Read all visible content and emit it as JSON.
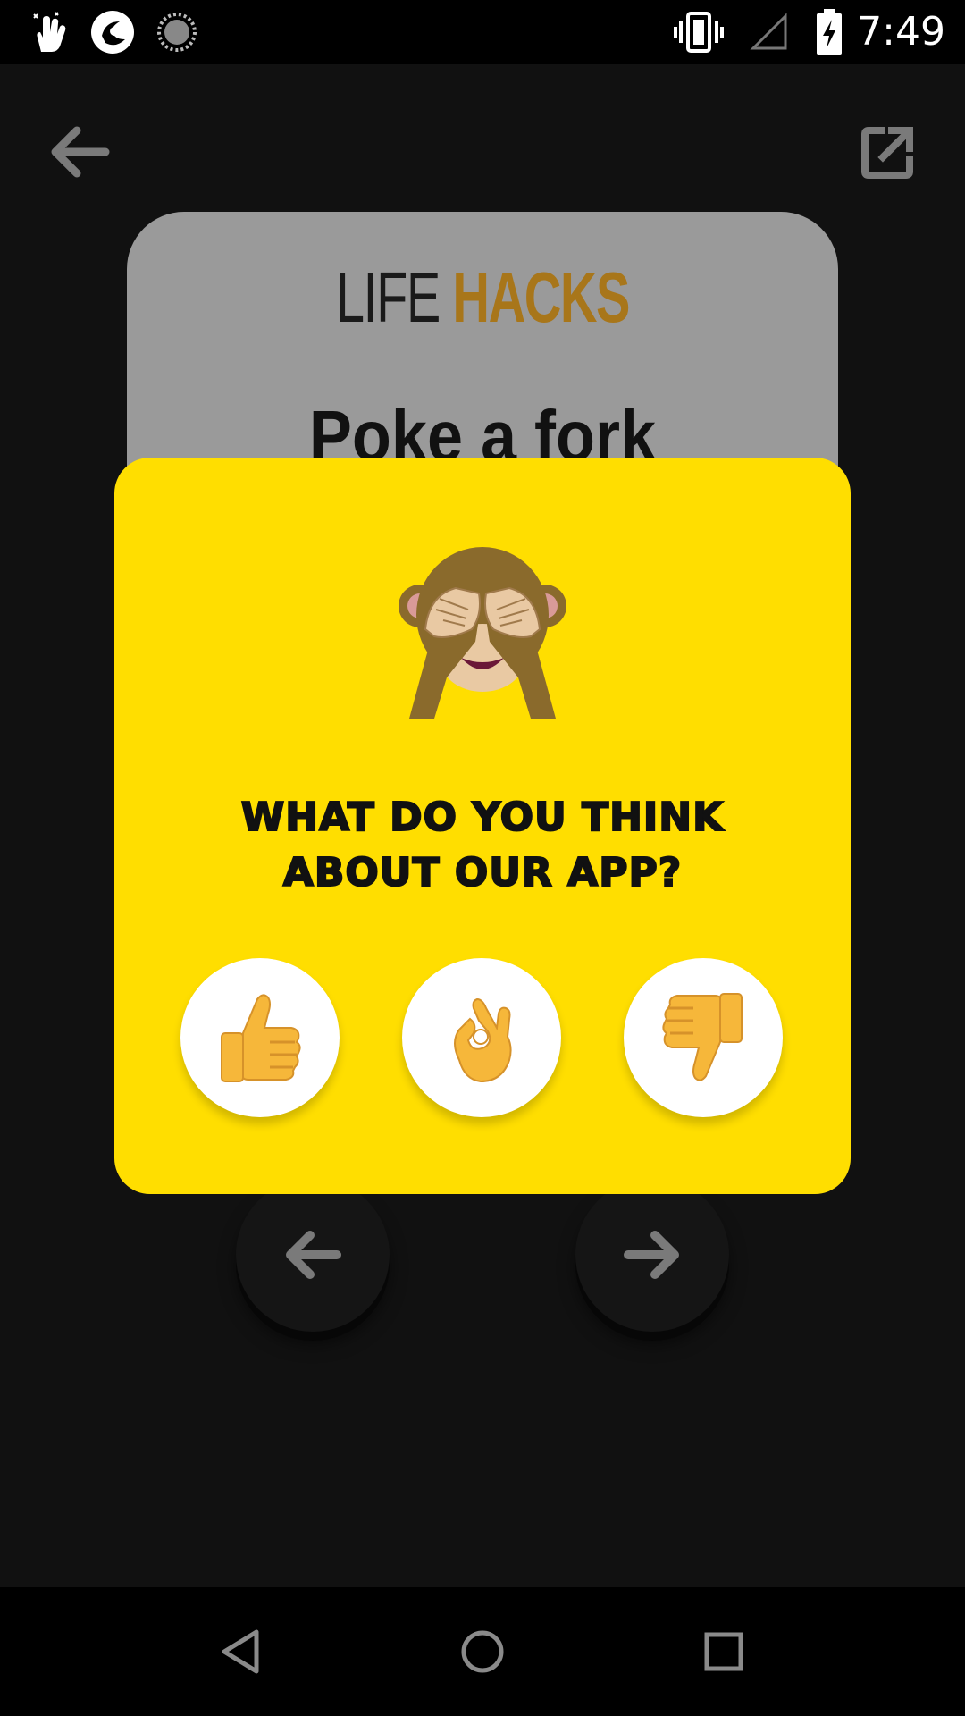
{
  "status_bar": {
    "time": "7:49",
    "icons": [
      "gesture-icon",
      "app-notification-icon",
      "sync-spinner-icon",
      "vibrate-icon",
      "signal-icon",
      "battery-charging-icon"
    ]
  },
  "app_bar": {
    "back_icon": "arrow-left-icon",
    "share_icon": "share-external-icon"
  },
  "card": {
    "title_part1": "LIFE",
    "title_part2": "HACKS",
    "text": "Poke a fork"
  },
  "rating_modal": {
    "icon": "see-no-evil-monkey-icon",
    "question_line1": "WHAT DO YOU THINK",
    "question_line2": "ABOUT OUR APP?",
    "options": [
      "thumbs-up-icon",
      "ok-hand-icon",
      "thumbs-down-icon"
    ]
  },
  "navigation": {
    "prev_icon": "arrow-left-icon",
    "next_icon": "arrow-right-icon"
  },
  "system_nav": [
    "back-triangle-icon",
    "home-circle-icon",
    "recents-square-icon"
  ],
  "colors": {
    "background": "#111111",
    "modal": "#ffde00",
    "card": "#9a9a9a",
    "accent": "#a8761a"
  }
}
